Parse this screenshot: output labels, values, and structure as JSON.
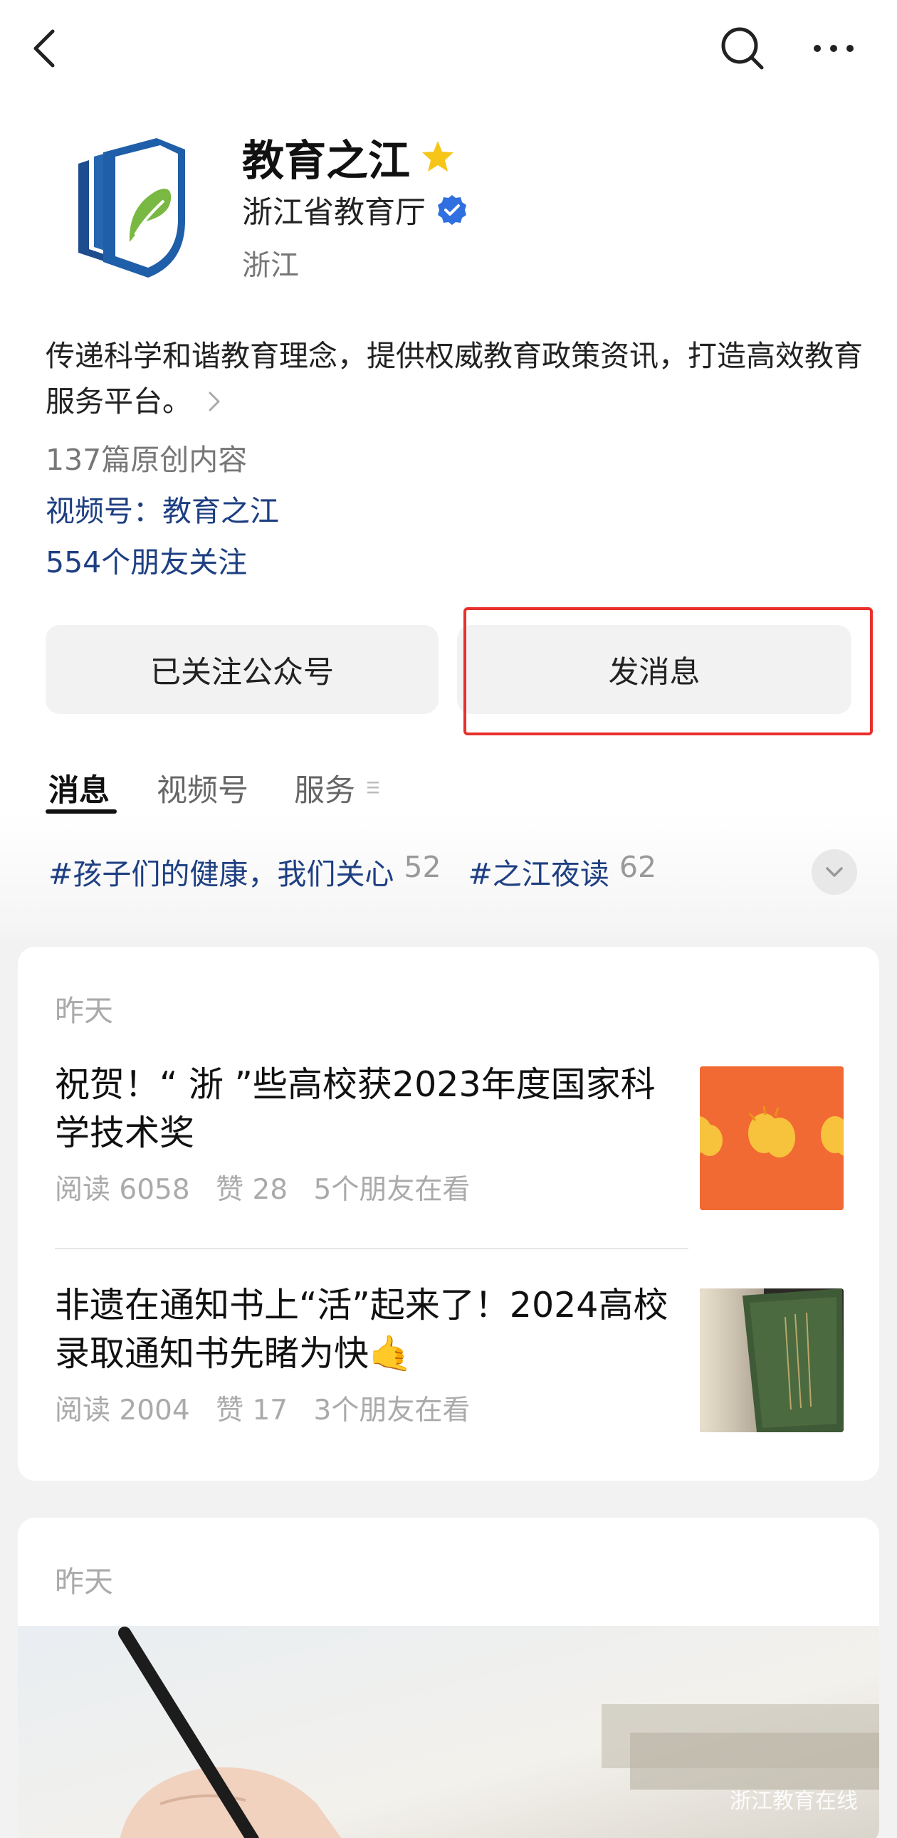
{
  "profile": {
    "name": "教育之江",
    "organization": "浙江省教育厅",
    "region": "浙江",
    "bio": "传递科学和谐教育理念，提供权威教育政策资讯，打造高效教育服务平台。",
    "original_count": "137篇原创内容",
    "video_channel": "视频号：教育之江",
    "friends_following": "554个朋友关注"
  },
  "actions": {
    "follow_label": "已关注公众号",
    "message_label": "发消息"
  },
  "tabs": [
    {
      "label": "消息"
    },
    {
      "label": "视频号"
    },
    {
      "label": "服务"
    }
  ],
  "tags": [
    {
      "text": "#孩子们的健康，我们关心",
      "count": "52"
    },
    {
      "text": "#之江夜读",
      "count": "62"
    }
  ],
  "feed": [
    {
      "date": "昨天",
      "articles": [
        {
          "title": "祝贺！“ 浙 ”些高校获2023年度国家科学技术奖",
          "reads": "阅读 6058",
          "likes": "赞 28",
          "friends": "5个朋友在看"
        },
        {
          "title": "非遗在通知书上“活”起来了！2024高校录取通知书先睹为快🤙",
          "reads": "阅读 2004",
          "likes": "赞 17",
          "friends": "3个朋友在看"
        }
      ]
    },
    {
      "date": "昨天",
      "watermark": "浙江教育在线"
    }
  ],
  "colors": {
    "link": "#1e3f82",
    "highlight": "#e8302c",
    "verified": "#2f6fe0",
    "star": "#f5c518"
  },
  "icons": [
    "back-arrow-icon",
    "search-icon",
    "more-icon",
    "star-icon",
    "verified-icon",
    "chevron-right-icon",
    "menu-lines-icon",
    "chevron-down-icon"
  ]
}
